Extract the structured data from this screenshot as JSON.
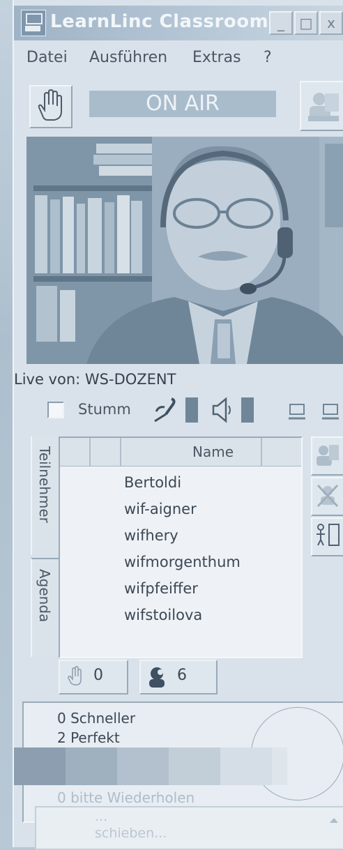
{
  "window": {
    "title": "LearnLinc Classroom",
    "controls": [
      "_",
      "□",
      "x"
    ]
  },
  "menu": [
    "Datei",
    "Ausführen",
    "Extras",
    "?"
  ],
  "toolbar": {
    "on_air": "ON AIR"
  },
  "video": {
    "live_label": "Live von: WS-DOZENT"
  },
  "audio": {
    "mute_label": "Stumm",
    "mute_checked": false,
    "mic_icon": "microphone-icon",
    "speaker_icon": "speaker-icon"
  },
  "participants": {
    "tabs": [
      "Teilnehmer",
      "Agenda"
    ],
    "column_header": "Name",
    "names": [
      "Bertoldi",
      "wif-aigner",
      "wifhery",
      "wifmorgenthum",
      "wifpfeiffer",
      "wifstoilova"
    ],
    "raised_hands_count": "0",
    "online_count": "6"
  },
  "feedback": {
    "lines": [
      "0 Schneller",
      "2 Perfekt",
      "0 bitte Wiederholen"
    ]
  },
  "chat": {
    "lines": [
      "...",
      "schieben..."
    ]
  },
  "colors": {
    "background": "#b7c8d6",
    "onair_bar": "#a9bccc",
    "level_meter": "#6f8598"
  }
}
